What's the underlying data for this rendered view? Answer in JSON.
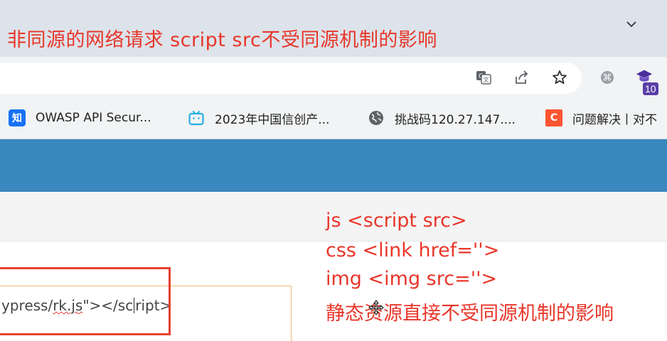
{
  "tabstrip": {
    "annotation_title": "非同源的网络请求  script  src不受同源机制的影响",
    "chevron_icon": "chevron-down-icon"
  },
  "toolbar": {
    "icons": [
      "translate-icon",
      "share-icon",
      "star-icon",
      "extension-icon",
      "graduation-cap-icon"
    ],
    "extension_badge": "10"
  },
  "bookmarks": [
    {
      "icon": "zhihu-icon",
      "icon_text": "知",
      "icon_color": "#1772f6",
      "label": "OWASP API Secur..."
    },
    {
      "icon": "bilibili-icon",
      "icon_text": "",
      "icon_color": "#23ade5",
      "label": "2023年中国信创产..."
    },
    {
      "icon": "globe-icon",
      "icon_text": "",
      "icon_color": "#555555",
      "label": "挑战码120.27.147...."
    },
    {
      "icon": "csdn-icon",
      "icon_text": "C",
      "icon_color": "#fc5531",
      "label": "问题解决丨对不"
    }
  ],
  "colors": {
    "header": "#3a88bf",
    "annotation": "#e8362a"
  },
  "editor": {
    "line_prefix": "ypress/",
    "line_file": "rk.js",
    "line_mid": "\"></sc",
    "line_suffix": "ript>"
  },
  "annotations": [
    "js   <script src>",
    "css  <link href=''>",
    "img  <img src=''>",
    "静态资源直接不受同源机制的影响"
  ]
}
